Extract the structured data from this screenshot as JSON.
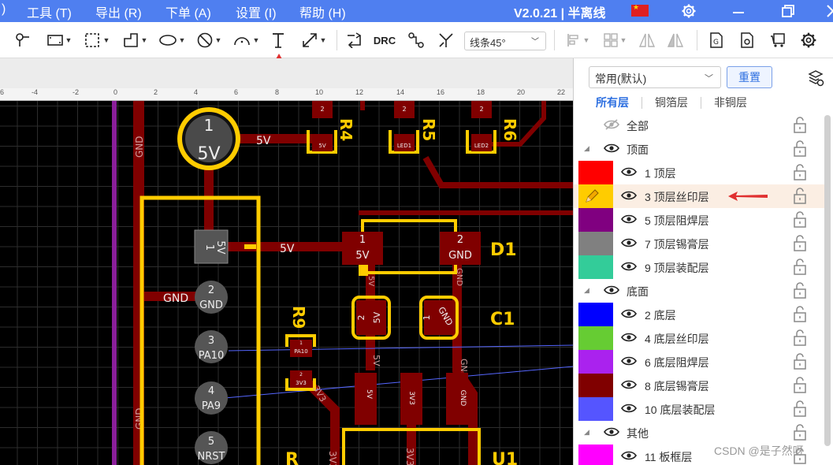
{
  "menubar": {
    "left_fragment": ")",
    "items": [
      "工具 (T)",
      "导出 (R)",
      "下单 (A)",
      "设置 (I)",
      "帮助 (H)"
    ],
    "version": "V2.0.21 | 半离线",
    "icons": [
      "gear-icon",
      "minimize-icon",
      "restore-icon",
      "close-icon"
    ]
  },
  "toolbar": {
    "drc_label": "DRC",
    "line_mode": "线条45°"
  },
  "ruler": {
    "labels": [
      "6",
      "-4",
      "-2",
      "0",
      "2",
      "4",
      "6",
      "8",
      "10",
      "12",
      "14",
      "16",
      "18",
      "20",
      "22"
    ]
  },
  "pcb": {
    "pin1_big_num": "1",
    "pin1_big_net": "5V",
    "net_5v": "5V",
    "net_gnd": "GND",
    "net_3v3": "3V3",
    "net_pa10": "PA10",
    "net_pa9": "PA9",
    "net_nrst": "NRST",
    "pins": [
      {
        "num": "1",
        "net": "5V"
      },
      {
        "num": "2",
        "net": "GND"
      },
      {
        "num": "3",
        "net": "PA10"
      },
      {
        "num": "4",
        "net": "PA9"
      },
      {
        "num": "5",
        "net": "NRST"
      }
    ],
    "designators": [
      "R4",
      "R5",
      "R6",
      "D1",
      "C1",
      "R9",
      "U1",
      "R"
    ],
    "pad_labels": {
      "r4": "5V",
      "r5": "LED1",
      "r6": "LED2",
      "two": "2",
      "one": "1"
    }
  },
  "panel": {
    "preset": "常用(默认)",
    "reset_label": "重置",
    "tabs": [
      "所有层",
      "铜箔层",
      "非铜层"
    ],
    "layers": [
      {
        "label": "全部",
        "type": "all"
      },
      {
        "label": "顶面",
        "type": "group"
      },
      {
        "label": "1 顶层",
        "color": "#ff0000"
      },
      {
        "label": "3 顶层丝印层",
        "color": "#ffcc00",
        "active": true
      },
      {
        "label": "5 顶层阻焊层",
        "color": "#800080"
      },
      {
        "label": "7 顶层锡膏层",
        "color": "#808080"
      },
      {
        "label": "9 顶层装配层",
        "color": "#33cc99"
      },
      {
        "label": "底面",
        "type": "group"
      },
      {
        "label": "2 底层",
        "color": "#0000ff"
      },
      {
        "label": "4 底层丝印层",
        "color": "#66cc33"
      },
      {
        "label": "6 底层阻焊层",
        "color": "#aa22ee"
      },
      {
        "label": "8 底层锡膏层",
        "color": "#800000"
      },
      {
        "label": "10 底层装配层",
        "color": "#5555ff"
      },
      {
        "label": "其他",
        "type": "group"
      },
      {
        "label": "11 板框层",
        "color": "#ff00ff"
      }
    ],
    "watermark": "CSDN @是子然呀"
  }
}
